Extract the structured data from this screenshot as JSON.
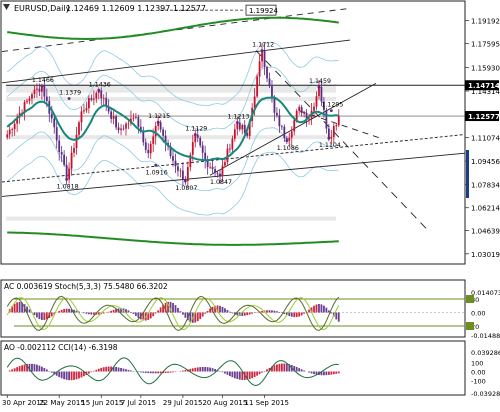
{
  "header": {
    "symbol_text": "EURUSD,Daily",
    "ohlc_text": "1.12469 1.12609 1.12397 1.12577"
  },
  "colors": {
    "up": "#c8102e",
    "down": "#5b2a86",
    "envelope": "#8ecbe0",
    "ma": "#17877a",
    "ma_outer": "#228b22",
    "trend": "#222222",
    "stoch_main": "#556b2f",
    "stoch_signal": "#9acd32",
    "level_bar": "#6b8e23",
    "price_box": "#1a3c8a"
  },
  "chart_data": [
    {
      "type": "candlestick",
      "title": "EURUSD,Daily",
      "y_ticks": [
        "1.19192",
        "1.17595",
        "1.15930",
        "1.14314",
        "1.12577",
        "1.11074",
        "1.09456",
        "1.07834",
        "1.06214",
        "1.04639",
        "1.03019"
      ],
      "x_ticks": [
        "30 Apr 2015",
        "22 May 2015",
        "15 Jun 2015",
        "7 Jul 2015",
        "29 Jul 2015",
        "20 Aug 2015",
        "11 Sep 2015"
      ],
      "ylim": [
        1.0245,
        1.2035
      ],
      "current_price": "1.12577",
      "level_price": "1.14714",
      "level_value": 1.14714,
      "current_value": 1.12577,
      "ma_value_label": "1.19924",
      "annotations": [
        {
          "text": "1.1466",
          "x": 14,
          "y": 1.1466
        },
        {
          "text": "1.1379",
          "x": 25,
          "y": 1.1379
        },
        {
          "text": "1.1436",
          "x": 37,
          "y": 1.1436
        },
        {
          "text": "1.1215",
          "x": 61,
          "y": 1.1215
        },
        {
          "text": "1.1129",
          "x": 76,
          "y": 1.1129
        },
        {
          "text": "1.1213",
          "x": 93,
          "y": 1.1213
        },
        {
          "text": "1.1712",
          "x": 103,
          "y": 1.1712
        },
        {
          "text": "1.1459",
          "x": 126,
          "y": 1.1459
        },
        {
          "text": "1.1295",
          "x": 131,
          "y": 1.1295
        },
        {
          "text": "1.1086",
          "x": 113,
          "y": 1.1086
        },
        {
          "text": "1.1104",
          "x": 130,
          "y": 1.1104
        },
        {
          "text": "1.0818",
          "x": 24,
          "y": 1.0818
        },
        {
          "text": "1.0916",
          "x": 60,
          "y": 1.0916
        },
        {
          "text": "1.0807",
          "x": 72,
          "y": 1.0807
        },
        {
          "text": "1.0847",
          "x": 86,
          "y": 1.0847
        }
      ],
      "pivots": [
        [
          0,
          1.113
        ],
        [
          5,
          1.128
        ],
        [
          10,
          1.141
        ],
        [
          14,
          1.1466
        ],
        [
          19,
          1.118
        ],
        [
          24,
          1.0818
        ],
        [
          30,
          1.129
        ],
        [
          37,
          1.1436
        ],
        [
          45,
          1.116
        ],
        [
          52,
          1.125
        ],
        [
          57,
          1.1
        ],
        [
          61,
          1.1215
        ],
        [
          66,
          1.098
        ],
        [
          72,
          1.0807
        ],
        [
          76,
          1.1129
        ],
        [
          80,
          1.095
        ],
        [
          86,
          1.0847
        ],
        [
          93,
          1.1213
        ],
        [
          97,
          1.112
        ],
        [
          103,
          1.1712
        ],
        [
          108,
          1.128
        ],
        [
          113,
          1.1086
        ],
        [
          118,
          1.132
        ],
        [
          122,
          1.124
        ],
        [
          126,
          1.1459
        ],
        [
          130,
          1.1104
        ],
        [
          134,
          1.1258
        ]
      ]
    },
    {
      "type": "bar",
      "title": "AC 0.003619 Stoch(5,3,3) 75.5480 66.3202",
      "y_ticks": [
        "0.014073",
        "80",
        "0.00",
        "20",
        "-0.014884"
      ],
      "upper_level": 80,
      "lower_level": 20
    },
    {
      "type": "bar",
      "title": "AO -0.002112 CCI(14) -6.3198",
      "y_ticks": [
        "0.039286",
        "100",
        "0.00",
        "-100",
        "-0.039288"
      ]
    }
  ]
}
